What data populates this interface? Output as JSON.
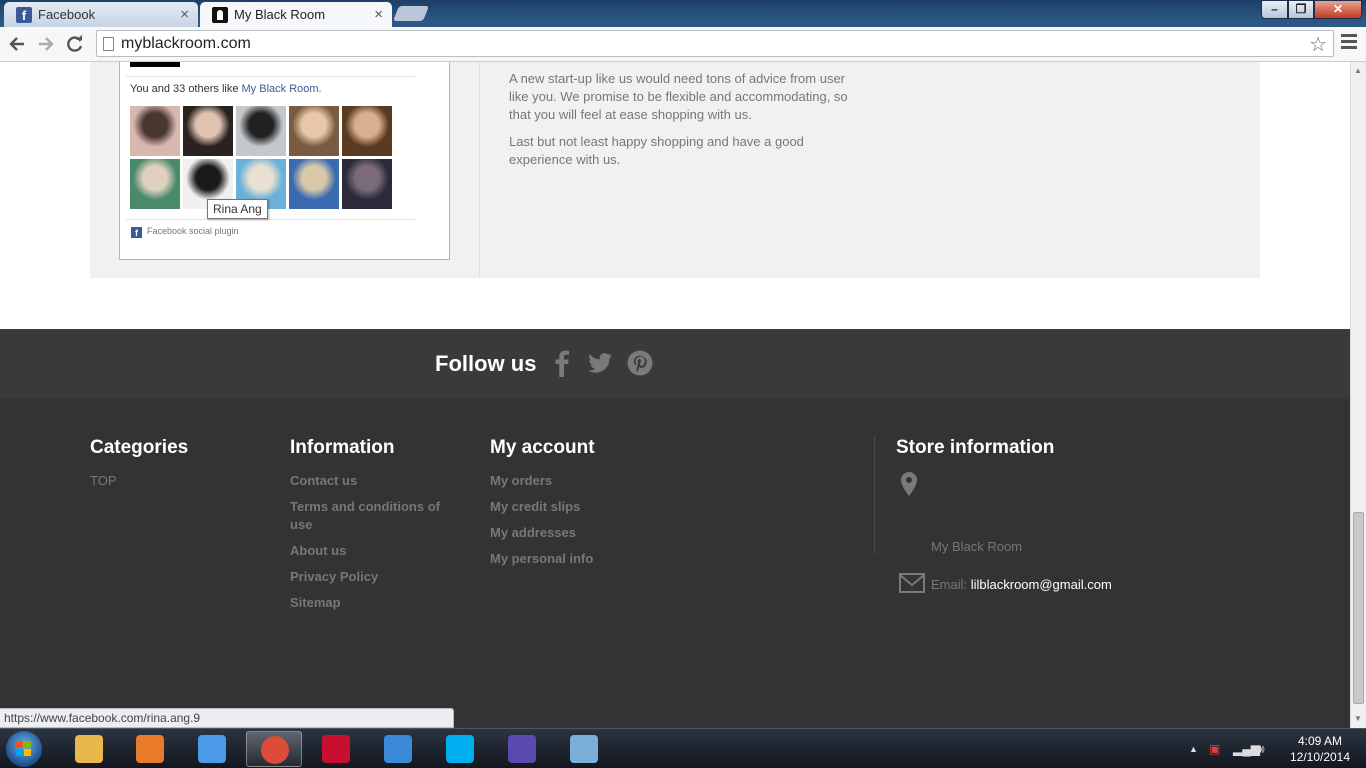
{
  "browser": {
    "tabs": [
      {
        "label": "Facebook",
        "icon": "facebook-favicon",
        "active": false
      },
      {
        "label": "My Black Room",
        "icon": "myblackroom-favicon",
        "active": true
      }
    ],
    "tab_close_glyph": "×",
    "url": "myblackroom.com",
    "status_url": "https://www.facebook.com/rina.ang.9"
  },
  "facebook_plugin": {
    "likes_prefix": "You and 33 others like ",
    "likes_page": "My Black Room.",
    "tooltip": "Rina Ang",
    "plugin_label": "Facebook social plugin",
    "faces": [
      {
        "colors": [
          "#d8b8ae",
          "#4a3630"
        ]
      },
      {
        "colors": [
          "#2a2220",
          "#e0c2b0"
        ]
      },
      {
        "colors": [
          "#c4c8cc",
          "#222222"
        ]
      },
      {
        "colors": [
          "#7a5a40",
          "#e8c8a8"
        ]
      },
      {
        "colors": [
          "#5a3a20",
          "#d8b090"
        ]
      },
      {
        "colors": [
          "#4a8a6a",
          "#e0d0c0"
        ]
      },
      {
        "colors": [
          "#f0f0f0",
          "#1a1a1a"
        ]
      },
      {
        "colors": [
          "#6ab0d8",
          "#e8e0d0"
        ]
      },
      {
        "colors": [
          "#3a6ab0",
          "#d8c8a8"
        ]
      },
      {
        "colors": [
          "#2a2a3a",
          "#7a6a7a"
        ]
      }
    ]
  },
  "about": {
    "paragraphs": [
      "A new start-up like us would need tons of advice from user like you. We promise to be flexible and accommodating, so that you will feel at ease shopping with us.",
      "Last but not least happy shopping and have a good experience with us."
    ]
  },
  "follow": {
    "title": "Follow us",
    "networks": [
      "facebook-icon",
      "twitter-icon",
      "pinterest-icon"
    ]
  },
  "footer": {
    "categories": {
      "title": "Categories",
      "links": [
        "TOP"
      ]
    },
    "information": {
      "title": "Information",
      "links": [
        "Contact us",
        "Terms and conditions of use",
        "About us",
        "Privacy Policy",
        "Sitemap"
      ]
    },
    "account": {
      "title": "My account",
      "links": [
        "My orders",
        "My credit slips",
        "My addresses",
        "My personal info"
      ]
    },
    "store": {
      "title": "Store information",
      "name": "My Black Room",
      "email_label": "Email: ",
      "email": "lilblackroom@gmail.com"
    }
  },
  "taskbar": {
    "time": "4:09 AM",
    "date": "12/10/2014",
    "apps": [
      {
        "name": "explorer",
        "color": "#e8b84a"
      },
      {
        "name": "media-player",
        "color": "#e87a2a"
      },
      {
        "name": "network",
        "color": "#4a9ae8"
      },
      {
        "name": "chrome",
        "color": "#dd4b39",
        "active": true
      },
      {
        "name": "quicktime",
        "color": "#c8102e"
      },
      {
        "name": "search-tool",
        "color": "#3a8ad8"
      },
      {
        "name": "skype",
        "color": "#00aff0"
      },
      {
        "name": "bittorrent",
        "color": "#5a4ab0"
      },
      {
        "name": "paint",
        "color": "#7ab0d8"
      }
    ]
  }
}
